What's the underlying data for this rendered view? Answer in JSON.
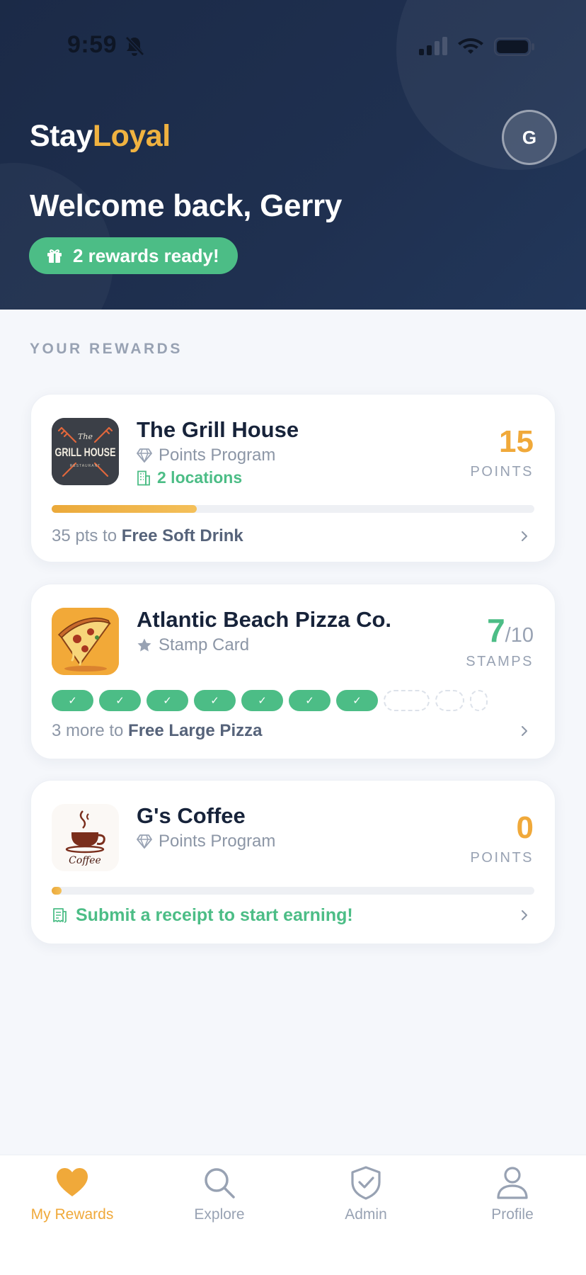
{
  "status_bar": {
    "time": "9:59"
  },
  "header": {
    "brand_primary": "Stay",
    "brand_accent": "Loyal",
    "avatar_initial": "G",
    "welcome": "Welcome back, Gerry",
    "rewards_ready": "2 rewards ready!"
  },
  "section_title": "YOUR REWARDS",
  "cards": [
    {
      "name": "The Grill House",
      "program": "Points Program",
      "locations": "2 locations",
      "logo_text": "GRILL HOUSE",
      "logo_script": "The",
      "logo_sub": "RESTAURANT",
      "value": "15",
      "unit": "POINTS",
      "progress_fraction": 0.3,
      "footer_prefix": "35 pts to ",
      "footer_reward": "Free Soft Drink"
    },
    {
      "name": "Atlantic Beach Pizza Co.",
      "program": "Stamp Card",
      "value": "7",
      "total": "/10",
      "unit": "STAMPS",
      "stamps_filled": 7,
      "stamps_total": 10,
      "footer_prefix": "3 more to ",
      "footer_reward": "Free Large Pizza"
    },
    {
      "name": "G's Coffee",
      "program": "Points Program",
      "logo_text": "Coffee",
      "value": "0",
      "unit": "POINTS",
      "progress_fraction": 0.02,
      "footer_text": "Submit a receipt to start earning!"
    }
  ],
  "tabs": [
    {
      "label": "My Rewards",
      "icon": "heart-icon",
      "active": true
    },
    {
      "label": "Explore",
      "icon": "search-icon",
      "active": false
    },
    {
      "label": "Admin",
      "icon": "shield-check-icon",
      "active": false
    },
    {
      "label": "Profile",
      "icon": "user-icon",
      "active": false
    }
  ],
  "colors": {
    "header_bg": "#1b2a47",
    "accent_gold": "#f0a93a",
    "accent_green": "#4cbd86",
    "muted_text": "#98a2b3"
  }
}
